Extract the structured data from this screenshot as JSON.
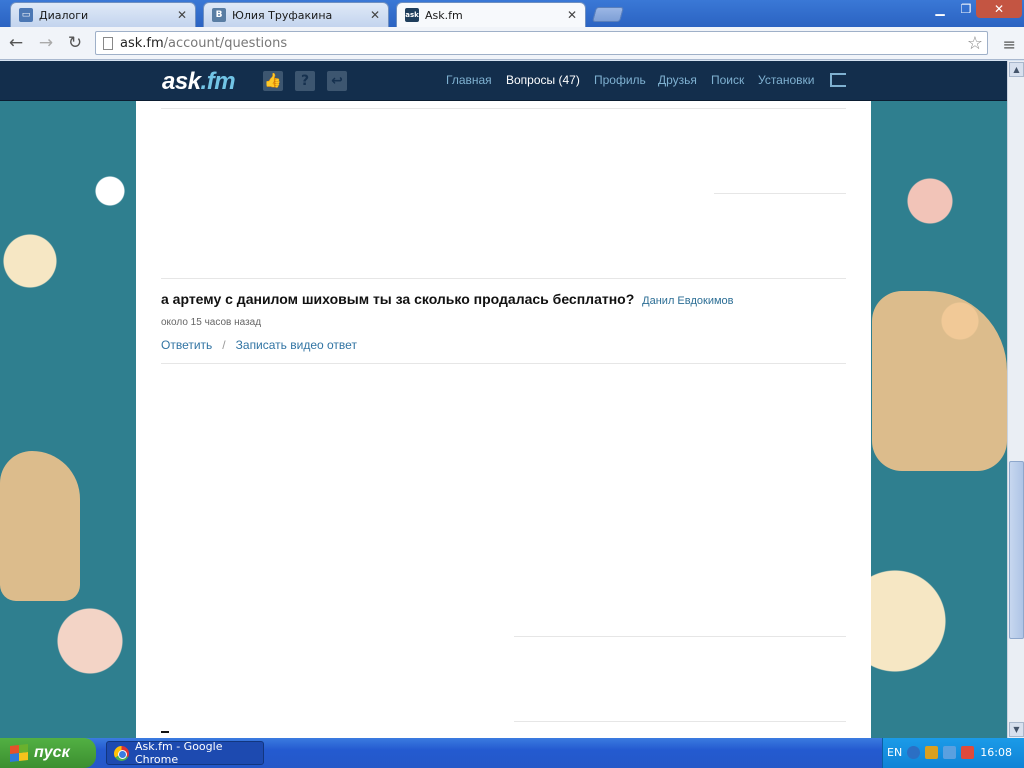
{
  "browser": {
    "tabs": [
      {
        "label": "Диалоги",
        "icon": "chat-icon"
      },
      {
        "label": "Юлия Труфакина",
        "icon": "vk-icon"
      },
      {
        "label": "Ask.fm",
        "icon": "askfm-icon"
      }
    ],
    "url_host": "ask.fm",
    "url_path": "/account/questions"
  },
  "site": {
    "logo_main": "ask",
    "logo_suffix": ".fm",
    "nav": [
      {
        "label": "Главная"
      },
      {
        "label": "Вопросы (47)"
      },
      {
        "label": "Профиль"
      },
      {
        "label": "Друзья"
      },
      {
        "label": "Поиск"
      },
      {
        "label": "Установки"
      }
    ]
  },
  "question": {
    "text": "а артему с данилом шиховым ты за сколько продалась бесплатно?",
    "asker": "Данил Евдокимов",
    "time": "около 15 часов назад",
    "reply_label": "Ответить",
    "separator": "/",
    "video_label": "Записать видео ответ"
  },
  "taskbar": {
    "start_label": "пуск",
    "window_label": "Ask.fm - Google Chrome",
    "lang": "EN",
    "clock": "16:08"
  },
  "colors": {
    "header_bg": "#132e4c",
    "link": "#3174a3",
    "page_bg": "#2f7f8f"
  }
}
